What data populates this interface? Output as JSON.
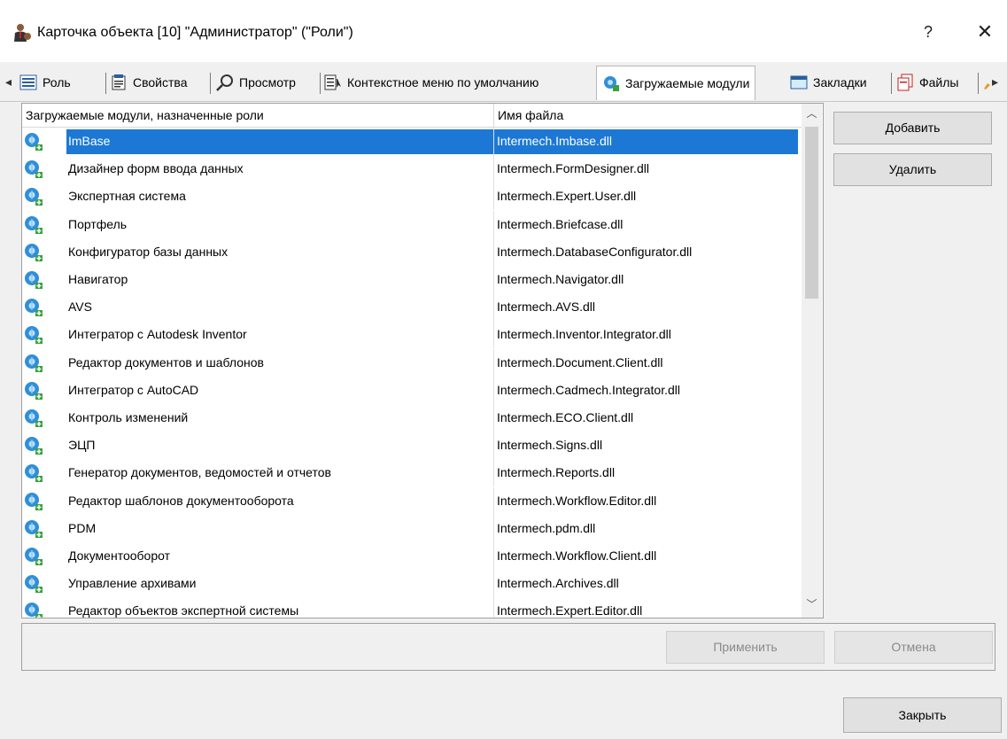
{
  "window": {
    "title": "Карточка объекта [10] \"Администратор\" (\"Роли\")",
    "help": "?",
    "close": "✕"
  },
  "tabs": [
    {
      "label": "Роль",
      "icon": "role-list-icon"
    },
    {
      "label": "Свойства",
      "icon": "properties-icon"
    },
    {
      "label": "Просмотр",
      "icon": "magnifier-icon"
    },
    {
      "label": "Контекстное меню по умолчанию",
      "icon": "context-menu-icon"
    },
    {
      "label": "Загружаемые модули",
      "icon": "modules-icon",
      "active": true
    },
    {
      "label": "Закладки",
      "icon": "bookmarks-icon"
    },
    {
      "label": "Файлы",
      "icon": "files-icon"
    }
  ],
  "tab_scroll": {
    "left": "◂",
    "right": "▸"
  },
  "grid": {
    "columns": [
      "Загружаемые модули, назначенные роли",
      "Имя файла"
    ],
    "rows": [
      {
        "name": "ImBase",
        "file": "Intermech.Imbase.dll",
        "selected": true
      },
      {
        "name": "Дизайнер форм ввода данных",
        "file": "Intermech.FormDesigner.dll"
      },
      {
        "name": "Экспертная система",
        "file": "Intermech.Expert.User.dll"
      },
      {
        "name": "Портфель",
        "file": "Intermech.Briefcase.dll"
      },
      {
        "name": "Конфигуратор базы данных",
        "file": "Intermech.DatabaseConfigurator.dll"
      },
      {
        "name": "Навигатор",
        "file": "Intermech.Navigator.dll"
      },
      {
        "name": "AVS",
        "file": "Intermech.AVS.dll"
      },
      {
        "name": "Интегратор с Autodesk Inventor",
        "file": "Intermech.Inventor.Integrator.dll"
      },
      {
        "name": "Редактор документов и шаблонов",
        "file": "Intermech.Document.Client.dll"
      },
      {
        "name": "Интегратор с AutoCAD",
        "file": "Intermech.Cadmech.Integrator.dll"
      },
      {
        "name": "Контроль изменений",
        "file": "Intermech.ECO.Client.dll"
      },
      {
        "name": "ЭЦП",
        "file": "Intermech.Signs.dll"
      },
      {
        "name": "Генератор документов, ведомостей и отчетов",
        "file": "Intermech.Reports.dll"
      },
      {
        "name": "Редактор шаблонов документооборота",
        "file": "Intermech.Workflow.Editor.dll"
      },
      {
        "name": "PDM",
        "file": "Intermech.pdm.dll"
      },
      {
        "name": "Документооборот",
        "file": "Intermech.Workflow.Client.dll"
      },
      {
        "name": "Управление архивами",
        "file": "Intermech.Archives.dll"
      },
      {
        "name": "Редактор объектов экспертной системы",
        "file": "Intermech.Expert.Editor.dll"
      }
    ]
  },
  "buttons": {
    "add": "Добавить",
    "delete": "Удалить",
    "apply": "Применить",
    "cancel": "Отмена",
    "close": "Закрыть"
  },
  "colors": {
    "selection": "#1c78d4",
    "background": "#f0f0f0"
  }
}
